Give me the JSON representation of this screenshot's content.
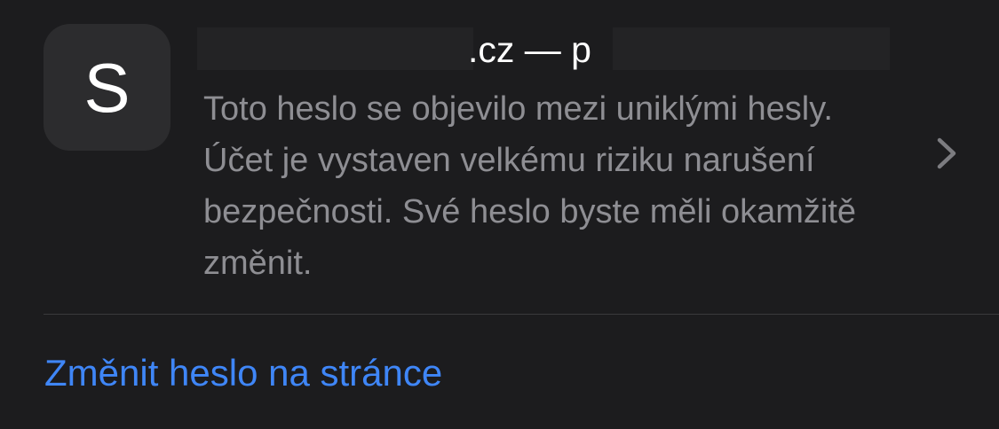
{
  "colors": {
    "background": "#1c1c1e",
    "avatar_bg": "#2c2c2e",
    "title_text": "#ffffff",
    "secondary_text": "#8e8e93",
    "separator": "#3a3a3c",
    "accent": "#3f86f7",
    "chevron": "#7c7c80"
  },
  "entry": {
    "avatar_letter": "S",
    "title_visible": ".cz — p",
    "title_redacted": true,
    "warning": "Toto heslo se objevilo mezi uniklými hesly. Účet je vystaven velkému riziku narušení bezpečnosti. Své heslo byste měli okamžitě změnit.",
    "disclosure_icon": "chevron-right-icon"
  },
  "action": {
    "label": "Změnit heslo na stránce"
  }
}
